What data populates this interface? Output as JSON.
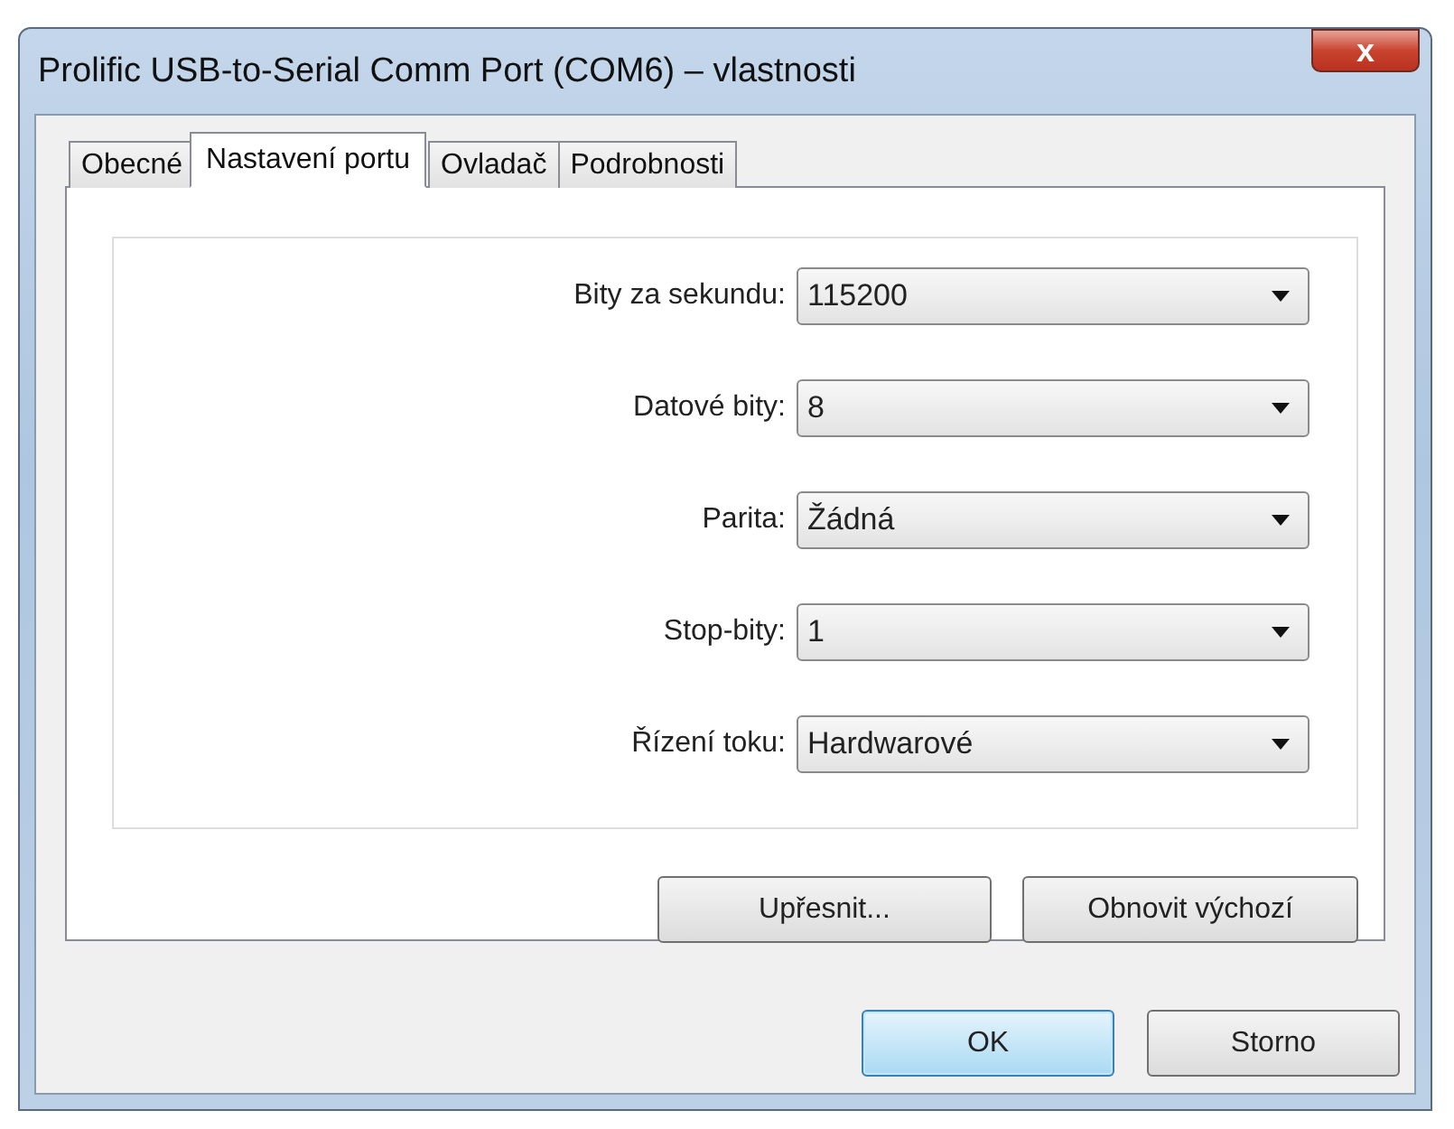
{
  "window": {
    "title": "Prolific USB-to-Serial Comm Port (COM6)  – vlastnosti",
    "close": "x"
  },
  "tabs": [
    {
      "label": "Obecné",
      "selected": false
    },
    {
      "label": "Nastavení portu",
      "selected": true
    },
    {
      "label": "Ovladač",
      "selected": false
    },
    {
      "label": "Podrobnosti",
      "selected": false
    }
  ],
  "settings": [
    {
      "label": "Bity za sekundu:",
      "value": "115200"
    },
    {
      "label": "Datové bity:",
      "value": "8"
    },
    {
      "label": "Parita:",
      "value": "Žádná"
    },
    {
      "label": "Stop-bity:",
      "value": "1"
    },
    {
      "label": "Řízení toku:",
      "value": "Hardwarové"
    }
  ],
  "panel_buttons": [
    "Upřesnit...",
    "Obnovit výchozí"
  ],
  "dialog_buttons": [
    {
      "label": "OK",
      "default": true
    },
    {
      "label": "Storno",
      "default": false
    }
  ]
}
